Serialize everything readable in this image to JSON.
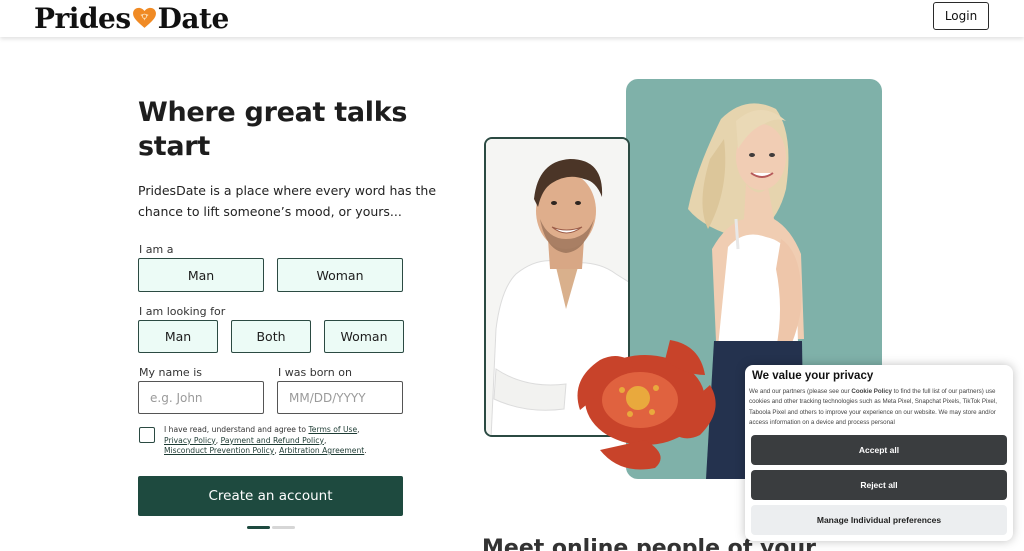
{
  "header": {
    "logo_left": "Prides",
    "logo_right": "Date",
    "login_label": "Login"
  },
  "hero": {
    "headline": "Where great talks start",
    "subtext": "PridesDate is a place where every word has the chance to lift someone’s mood, or yours...",
    "bottom_heading": "Meet online people of your"
  },
  "form": {
    "i_am_label": "I am a",
    "i_am_options": [
      "Man",
      "Woman"
    ],
    "looking_for_label": "I am looking for",
    "looking_for_options": [
      "Man",
      "Both",
      "Woman"
    ],
    "name_label": "My name is",
    "name_placeholder": "e.g. John",
    "dob_label": "I was born on",
    "dob_placeholder": "MM/DD/YYYY",
    "terms_prefix": "I have read, understand and agree to ",
    "terms_of_use": "Terms of Use",
    "privacy_policy": "Privacy Policy",
    "payment_refund": "Payment and Refund Policy",
    "misconduct": "Misconduct Prevention Policy",
    "arbitration": "Arbitration Agreement",
    "create_label": "Create an account"
  },
  "cookie": {
    "title": "We value your privacy",
    "text_before": "We and our partners (please see our ",
    "cookie_policy": "Cookie Policy",
    "text_after": " to find the full list of our partners) use cookies and other tracking technologies such as Meta Pixel, Snapchat Pixels, TikTok Pixel, Taboola Pixel and others to improve your experience on our website. We may store and/or access information on a device and process personal",
    "accept_label": "Accept all",
    "reject_label": "Reject all",
    "manage_label": "Manage Individual preferences"
  },
  "colors": {
    "brand_dark_green": "#1e4a3f",
    "option_bg": "#ecfbf6",
    "teal_panel": "#7fb1a9",
    "logo_heart": "#f08a24",
    "cookie_button_dark": "#3a3d3f"
  },
  "icons": {
    "logo_heart": "heart-icon",
    "flower": "flower-decoration"
  }
}
